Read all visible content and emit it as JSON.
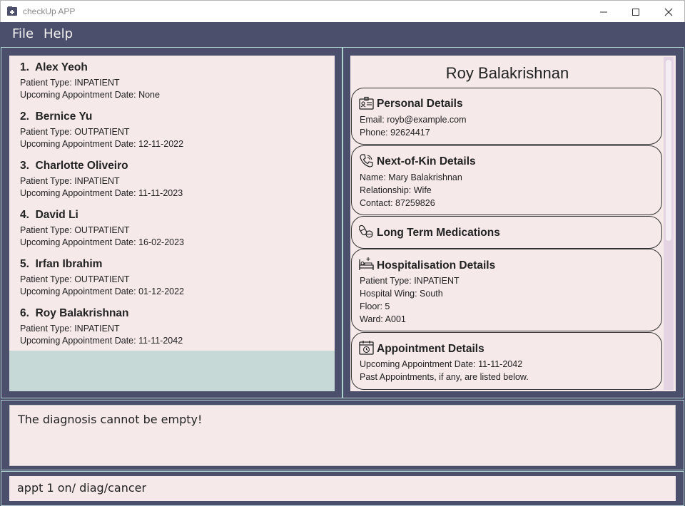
{
  "window": {
    "title": "checkUp APP",
    "minimize_icon": "minimize-icon",
    "maximize_icon": "maximize-icon",
    "close_icon": "close-icon"
  },
  "menu": {
    "file": "File",
    "help": "Help"
  },
  "colors": {
    "background": "#4c4f6b",
    "panel": "#f6e9ea",
    "border_accent": "#aed2cf",
    "list_empty": "#c6d9d7"
  },
  "patients": [
    {
      "index": "1.",
      "name": "Alex Yeoh",
      "type": "Patient Type: INPATIENT",
      "appt": "Upcoming Appointment Date: None"
    },
    {
      "index": "2.",
      "name": "Bernice Yu",
      "type": "Patient Type: OUTPATIENT",
      "appt": "Upcoming Appointment Date: 12-11-2022"
    },
    {
      "index": "3.",
      "name": "Charlotte Oliveiro",
      "type": "Patient Type: INPATIENT",
      "appt": "Upcoming Appointment Date: 11-11-2023"
    },
    {
      "index": "4.",
      "name": "David Li",
      "type": "Patient Type: OUTPATIENT",
      "appt": "Upcoming Appointment Date: 16-02-2023"
    },
    {
      "index": "5.",
      "name": "Irfan Ibrahim",
      "type": "Patient Type: OUTPATIENT",
      "appt": "Upcoming Appointment Date: 01-12-2022"
    },
    {
      "index": "6.",
      "name": "Roy Balakrishnan",
      "type": "Patient Type: INPATIENT",
      "appt": "Upcoming Appointment Date: 11-11-2042"
    }
  ],
  "details": {
    "name": "Roy Balakrishnan",
    "personal": {
      "title": "Personal Details",
      "icon": "id-card-icon",
      "lines": [
        "Email: royb@example.com",
        "Phone: 92624417"
      ]
    },
    "next_of_kin": {
      "title": "Next-of-Kin Details",
      "icon": "phone-contact-icon",
      "lines": [
        "Name: Mary Balakrishnan",
        "Relationship: Wife",
        "Contact: 87259826"
      ]
    },
    "medications": {
      "title": "Long Term Medications",
      "icon": "pills-icon",
      "lines": []
    },
    "hospitalisation": {
      "title": "Hospitalisation Details",
      "icon": "hospital-bed-icon",
      "lines": [
        "Patient Type: INPATIENT",
        "Hospital Wing: South",
        "Floor: 5",
        "Ward: A001"
      ]
    },
    "appointment": {
      "title": "Appointment Details",
      "icon": "calendar-icon",
      "lines": [
        "Upcoming Appointment Date: 11-11-2042",
        "Past Appointments, if any, are listed below."
      ]
    }
  },
  "result": {
    "text": "The diagnosis cannot be empty!"
  },
  "command": {
    "value": "appt 1 on/ diag/cancer"
  }
}
